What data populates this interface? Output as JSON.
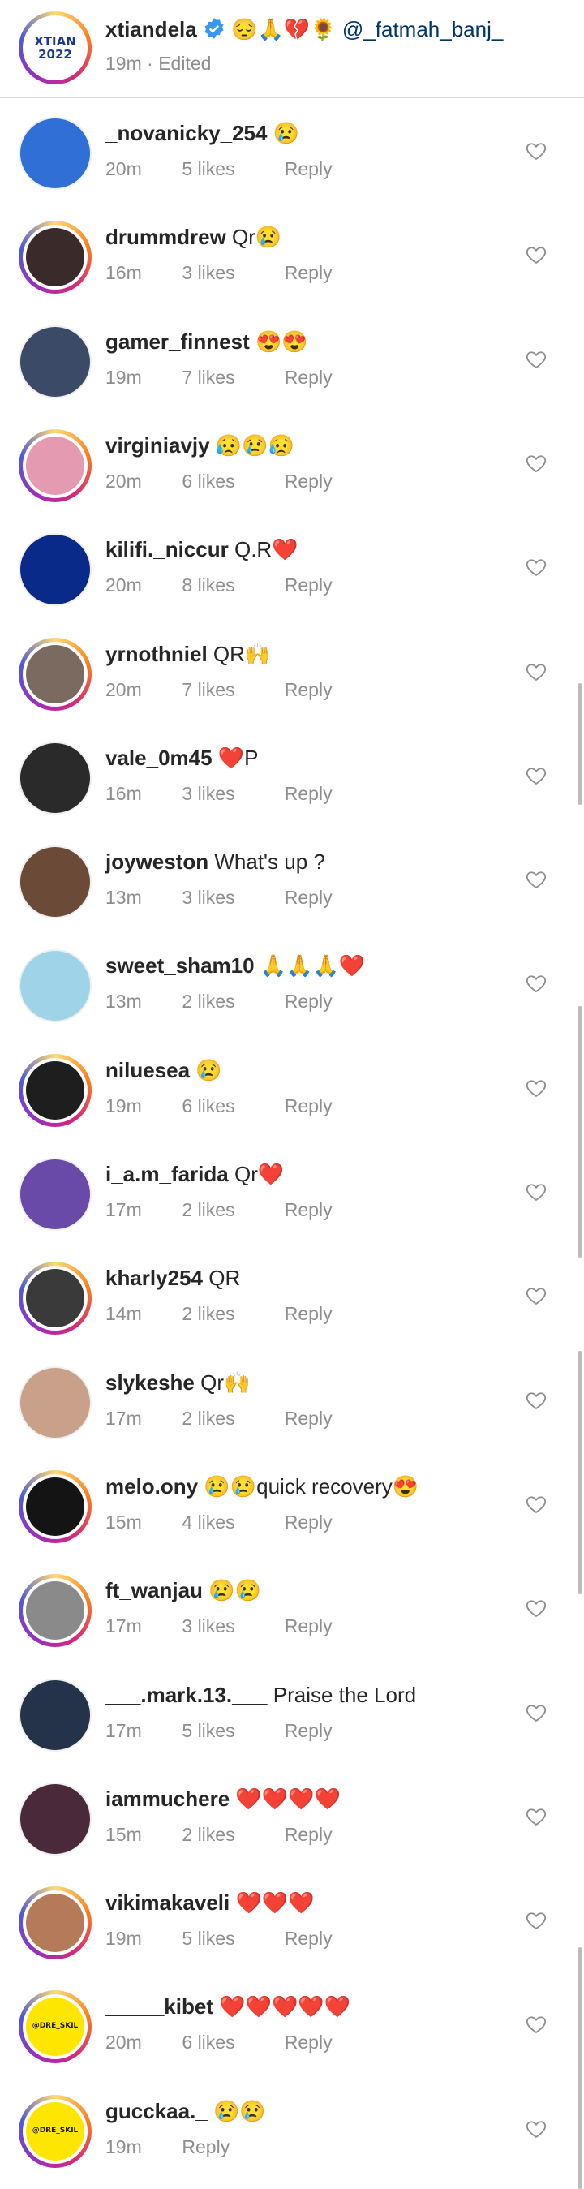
{
  "header": {
    "username": "xtiandela",
    "comment": "😔🙏💔🌻 @_fatmah_banj_",
    "time": "19m",
    "edited": "· Edited",
    "avatar_text": "XTIAN 2022"
  },
  "reply_label": "Reply",
  "comments": [
    {
      "username": "_novanicky_254",
      "comment": "😢",
      "time": "20m",
      "likes": "5 likes",
      "ring": false,
      "avatar_color": "#2f6fd6"
    },
    {
      "username": "drummdrew",
      "comment": "Qr😢",
      "time": "16m",
      "likes": "3 likes",
      "ring": true,
      "avatar_color": "#3a2a2a"
    },
    {
      "username": "gamer_finnest",
      "comment": "😍😍",
      "time": "19m",
      "likes": "7 likes",
      "ring": false,
      "avatar_color": "#3b4a66"
    },
    {
      "username": "virginiavjy",
      "comment": "😥😢😥",
      "time": "20m",
      "likes": "6 likes",
      "ring": true,
      "avatar_color": "#e49ab0"
    },
    {
      "username": "kilifi._niccur",
      "comment": "Q.R❤️",
      "time": "20m",
      "likes": "8 likes",
      "ring": false,
      "avatar_color": "#0a2a8a"
    },
    {
      "username": "yrnothniel",
      "comment": "QR🙌",
      "time": "20m",
      "likes": "7 likes",
      "ring": true,
      "avatar_color": "#7a6a60"
    },
    {
      "username": "vale_0m45",
      "comment": "❤️P",
      "time": "16m",
      "likes": "3 likes",
      "ring": false,
      "avatar_color": "#2a2a2a"
    },
    {
      "username": "joyweston",
      "comment": "What's up ?",
      "time": "13m",
      "likes": "3 likes",
      "ring": false,
      "avatar_color": "#6b4a38"
    },
    {
      "username": "sweet_sham10",
      "comment": "🙏🙏🙏❤️",
      "time": "13m",
      "likes": "2 likes",
      "ring": false,
      "avatar_color": "#9fd3e8"
    },
    {
      "username": "niluesea",
      "comment": "😢",
      "time": "19m",
      "likes": "6 likes",
      "ring": true,
      "avatar_color": "#1e1e1e"
    },
    {
      "username": "i_a.m_farida",
      "comment": "Qr❤️",
      "time": "17m",
      "likes": "2 likes",
      "ring": false,
      "avatar_color": "#6a4aa8"
    },
    {
      "username": "kharly254",
      "comment": "QR",
      "time": "14m",
      "likes": "2 likes",
      "ring": true,
      "avatar_color": "#3a3a3a"
    },
    {
      "username": "slykeshe",
      "comment": "Qr🙌",
      "time": "17m",
      "likes": "2 likes",
      "ring": false,
      "avatar_color": "#c9a08a"
    },
    {
      "username": "melo.ony",
      "comment": "😢😢quick recovery😍",
      "time": "15m",
      "likes": "4 likes",
      "ring": true,
      "avatar_color": "#141414"
    },
    {
      "username": "ft_wanjau",
      "comment": "😢😢",
      "time": "17m",
      "likes": "3 likes",
      "ring": true,
      "avatar_color": "#8a8a8a"
    },
    {
      "username": "___.mark.13.___",
      "comment": "Praise the Lord",
      "time": "17m",
      "likes": "5 likes",
      "ring": false,
      "avatar_color": "#24324a"
    },
    {
      "username": "iammuchere",
      "comment": "❤️❤️❤️❤️",
      "time": "15m",
      "likes": "2 likes",
      "ring": false,
      "avatar_color": "#4a2a3a"
    },
    {
      "username": "vikimakaveli",
      "comment": "❤️❤️❤️",
      "time": "19m",
      "likes": "5 likes",
      "ring": true,
      "avatar_color": "#b57a5a"
    },
    {
      "username": "_____kibet",
      "comment": "❤️❤️❤️❤️❤️",
      "time": "20m",
      "likes": "6 likes",
      "ring": true,
      "avatar_color": "#ffe600",
      "avatar_text": "@DRE_SKIL"
    },
    {
      "username": "gucckaa._",
      "comment": "😢😢",
      "time": "19m",
      "likes": "",
      "ring": true,
      "avatar_color": "#ffe600",
      "avatar_text": "@DRE_SKIL"
    }
  ],
  "colors": {
    "text": "#262626",
    "meta": "#8e8e8e",
    "mention": "#00376b",
    "verified": "#3897f0"
  }
}
